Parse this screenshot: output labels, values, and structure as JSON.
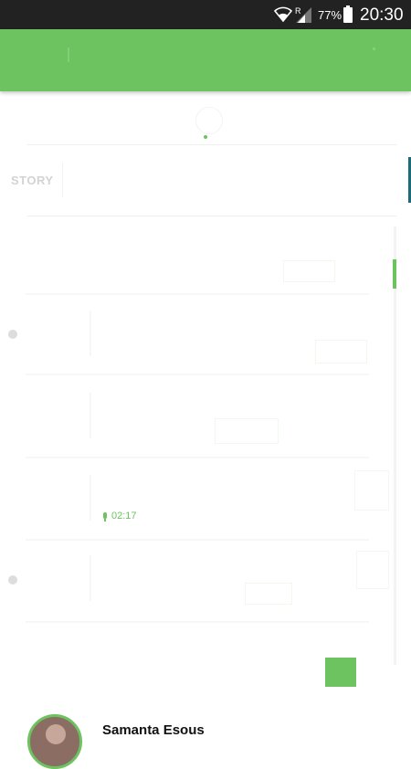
{
  "status_bar": {
    "battery_percent": "77%",
    "time": "20:30",
    "signal_label": "R",
    "wifi_icon": "wifi-icon",
    "signal_icon": "signal-icon",
    "battery_icon": "battery-icon"
  },
  "app_bar": {
    "color": "#6cc35f"
  },
  "tabs": {
    "story_label": "STORY"
  },
  "feed": {
    "audio_duration": "02:17",
    "mic_icon": "microphone-icon"
  },
  "profile": {
    "name": "Samanta Esous"
  },
  "colors": {
    "accent": "#6cc35f",
    "status_bar": "#222222"
  }
}
